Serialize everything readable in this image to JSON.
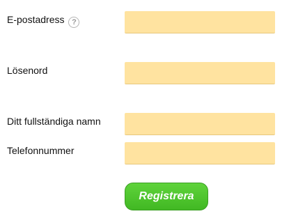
{
  "form": {
    "email": {
      "label": "E-postadress",
      "help_icon": "?",
      "value": "",
      "placeholder": ""
    },
    "password": {
      "label": "Lösenord",
      "value": "",
      "placeholder": ""
    },
    "full_name": {
      "label": "Ditt fullständiga namn",
      "value": "",
      "placeholder": ""
    },
    "phone": {
      "label": "Telefonnummer",
      "value": "",
      "placeholder": ""
    },
    "submit_label": "Registrera"
  },
  "colors": {
    "field_background": "#ffe3a0",
    "button_green": "#4cc52c"
  },
  "icons": {
    "help": "question-circle-icon"
  }
}
